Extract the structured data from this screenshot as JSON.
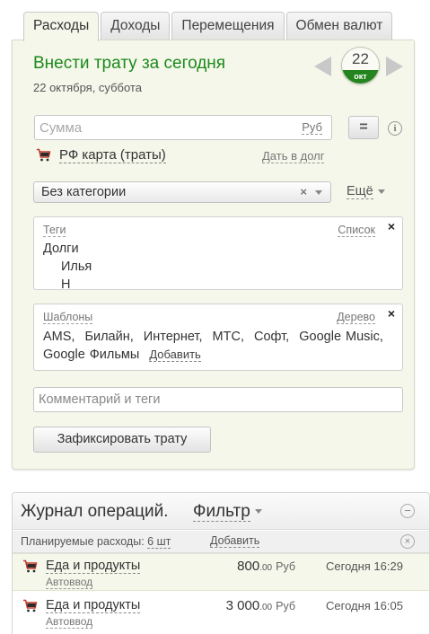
{
  "tabs": [
    "Расходы",
    "Доходы",
    "Перемещения",
    "Обмен валют"
  ],
  "form": {
    "title": "Внести трату за сегодня",
    "date_text": "22 октября, суббота",
    "date_badge": {
      "day": "22",
      "month": "окт"
    },
    "amount_placeholder": "Сумма",
    "currency": "Руб",
    "equals_label": "=",
    "info_label": "i",
    "account": "РФ карта (траты)",
    "loan_link": "Дать в долг",
    "category": "Без категории",
    "category_clear": "×",
    "more_label": "Ещё",
    "tags": {
      "header": "Теги",
      "list_link": "Список",
      "close": "×",
      "items": [
        "Долги",
        "Илья",
        "Н"
      ]
    },
    "templates": {
      "header": "Шаблоны",
      "tree_link": "Дерево",
      "close": "×",
      "items": [
        "AMS,",
        "Билайн,",
        "Интернет,",
        "МТС,",
        "Софт,",
        "Google Music,",
        "Google Фильмы"
      ],
      "add_link": "Добавить"
    },
    "comment_placeholder": "Комментарий и теги",
    "submit_label": "Зафиксировать трату"
  },
  "journal": {
    "title": "Журнал операций.",
    "filter_label": "Фильтр",
    "collapse_label": "−",
    "planned": {
      "label": "Планируемые расходы:",
      "count": "6 шт",
      "add_link": "Добавить",
      "dismiss": "×"
    },
    "rows": [
      {
        "category": "Еда и продукты",
        "source": "Автоввод",
        "amount": "800",
        "decimals": ".00",
        "currency": "Руб",
        "time": "Сегодня 16:29"
      },
      {
        "category": "Еда и продукты",
        "source": "Автоввод",
        "amount": "3 000",
        "decimals": ".00",
        "currency": "Руб",
        "time": "Сегодня 16:05"
      }
    ]
  },
  "colors": {
    "accent_green": "#1b8a1b",
    "panel_bg": "#f5f7ea",
    "badge_green": "#24851f",
    "cart_red": "#c0392b"
  },
  "icons": [
    "cart-icon",
    "chevron-left-icon",
    "chevron-right-icon",
    "info-icon",
    "close-icon",
    "dropdown-arrow-icon",
    "minus-circle-icon"
  ]
}
